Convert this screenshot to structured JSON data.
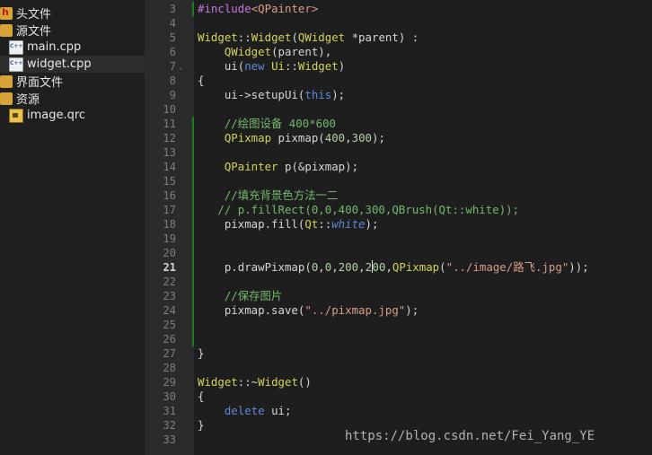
{
  "sidebar": {
    "items": [
      {
        "label": "头文件",
        "icon": "header-folder-icon"
      },
      {
        "label": "源文件",
        "icon": "source-folder-icon"
      },
      {
        "label": "main.cpp",
        "icon": "cpp-file-icon"
      },
      {
        "label": "widget.cpp",
        "icon": "cpp-file-icon",
        "selected": true
      },
      {
        "label": "界面文件",
        "icon": "forms-folder-icon"
      },
      {
        "label": "资源",
        "icon": "resources-folder-icon"
      },
      {
        "label": "image.qrc",
        "icon": "qrc-file-icon"
      }
    ]
  },
  "editor": {
    "current_line": "21",
    "lines": [
      {
        "n": "3",
        "text": "#include<QPainter>"
      },
      {
        "n": "4",
        "text": ""
      },
      {
        "n": "5",
        "text": "Widget::Widget(QWidget *parent) :"
      },
      {
        "n": "6",
        "text": "    QWidget(parent),"
      },
      {
        "n": "7",
        "text": "    ui(new Ui::Widget)"
      },
      {
        "n": "8",
        "text": "{"
      },
      {
        "n": "9",
        "text": "    ui->setupUi(this);"
      },
      {
        "n": "10",
        "text": ""
      },
      {
        "n": "11",
        "text": "    //绘图设备 400*600"
      },
      {
        "n": "12",
        "text": "    QPixmap pixmap(400,300);"
      },
      {
        "n": "13",
        "text": ""
      },
      {
        "n": "14",
        "text": "    QPainter p(&pixmap);"
      },
      {
        "n": "15",
        "text": ""
      },
      {
        "n": "16",
        "text": "    //填充背景色方法一二"
      },
      {
        "n": "17",
        "text": "   // p.fillRect(0,0,400,300,QBrush(Qt::white));"
      },
      {
        "n": "18",
        "text": "    pixmap.fill(Qt::white);"
      },
      {
        "n": "19",
        "text": ""
      },
      {
        "n": "20",
        "text": ""
      },
      {
        "n": "21",
        "text": "    p.drawPixmap(0,0,200,200,QPixmap(\"../image/路飞.jpg\"));"
      },
      {
        "n": "22",
        "text": ""
      },
      {
        "n": "23",
        "text": "    //保存图片"
      },
      {
        "n": "24",
        "text": "    pixmap.save(\"../pixmap.jpg\");"
      },
      {
        "n": "25",
        "text": ""
      },
      {
        "n": "26",
        "text": ""
      },
      {
        "n": "27",
        "text": "}"
      },
      {
        "n": "28",
        "text": ""
      },
      {
        "n": "29",
        "text": "Widget::~Widget()"
      },
      {
        "n": "30",
        "text": "{"
      },
      {
        "n": "31",
        "text": "    delete ui;"
      },
      {
        "n": "32",
        "text": "}"
      },
      {
        "n": "33",
        "text": ""
      }
    ]
  },
  "watermark": "https://blog.csdn.net/Fei_Yang_YE",
  "colors": {
    "keyword": "#5f8ad6",
    "type": "#d2d25a",
    "string": "#d69d85",
    "number": "#b5cea8",
    "comment": "#73b86b",
    "preprocessor": "#c678dd"
  }
}
